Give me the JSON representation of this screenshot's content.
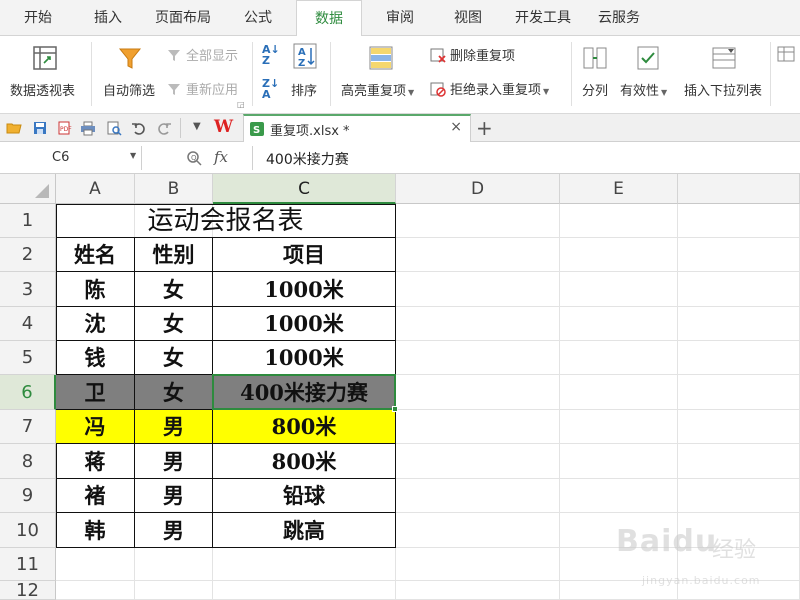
{
  "ribbon_tabs": [
    "开始",
    "插入",
    "页面布局",
    "公式",
    "数据",
    "审阅",
    "视图",
    "开发工具",
    "云服务"
  ],
  "active_tab": "数据",
  "ribbon": {
    "pivot_table": "数据透视表",
    "auto_filter": "自动筛选",
    "show_all": "全部显示",
    "reapply": "重新应用",
    "sort": "排序",
    "highlight_duplicates": "高亮重复项",
    "delete_duplicates": "删除重复项",
    "reject_duplicate_entry": "拒绝录入重复项",
    "split_column": "分列",
    "validity": "有效性",
    "insert_dropdown": "插入下拉列表"
  },
  "doc_tab": {
    "filename": "重复项.xlsx *",
    "close": "×",
    "new_tab": "+"
  },
  "formula_bar": {
    "cell_ref": "C6",
    "fx": "fx",
    "content": "400米接力赛"
  },
  "columns": [
    "A",
    "B",
    "C",
    "D",
    "E"
  ],
  "rows": [
    "1",
    "2",
    "3",
    "4",
    "5",
    "6",
    "7",
    "8",
    "9",
    "10",
    "11",
    "12"
  ],
  "sheet": {
    "title": "运动会报名表",
    "headers": [
      "姓名",
      "性别",
      "项目"
    ],
    "records": [
      {
        "name": "陈",
        "gender": "女",
        "event": "1000米",
        "highlight": "none"
      },
      {
        "name": "沈",
        "gender": "女",
        "event": "1000米",
        "highlight": "none"
      },
      {
        "name": "钱",
        "gender": "女",
        "event": "1000米",
        "highlight": "none"
      },
      {
        "name": "卫",
        "gender": "女",
        "event": "400米接力赛",
        "highlight": "gray"
      },
      {
        "name": "冯",
        "gender": "男",
        "event": "800米",
        "highlight": "yellow"
      },
      {
        "name": "蒋",
        "gender": "男",
        "event": "800米",
        "highlight": "none"
      },
      {
        "name": "褚",
        "gender": "男",
        "event": "铅球",
        "highlight": "none"
      },
      {
        "name": "韩",
        "gender": "男",
        "event": "跳高",
        "highlight": "none"
      }
    ]
  },
  "colors": {
    "accent": "#2e8b3e",
    "gray_fill": "#7f7f7f",
    "yellow_fill": "#ffff00"
  },
  "watermark": {
    "brand": "Baidu",
    "cn": "经验",
    "url": "jingyan.baidu.com"
  }
}
